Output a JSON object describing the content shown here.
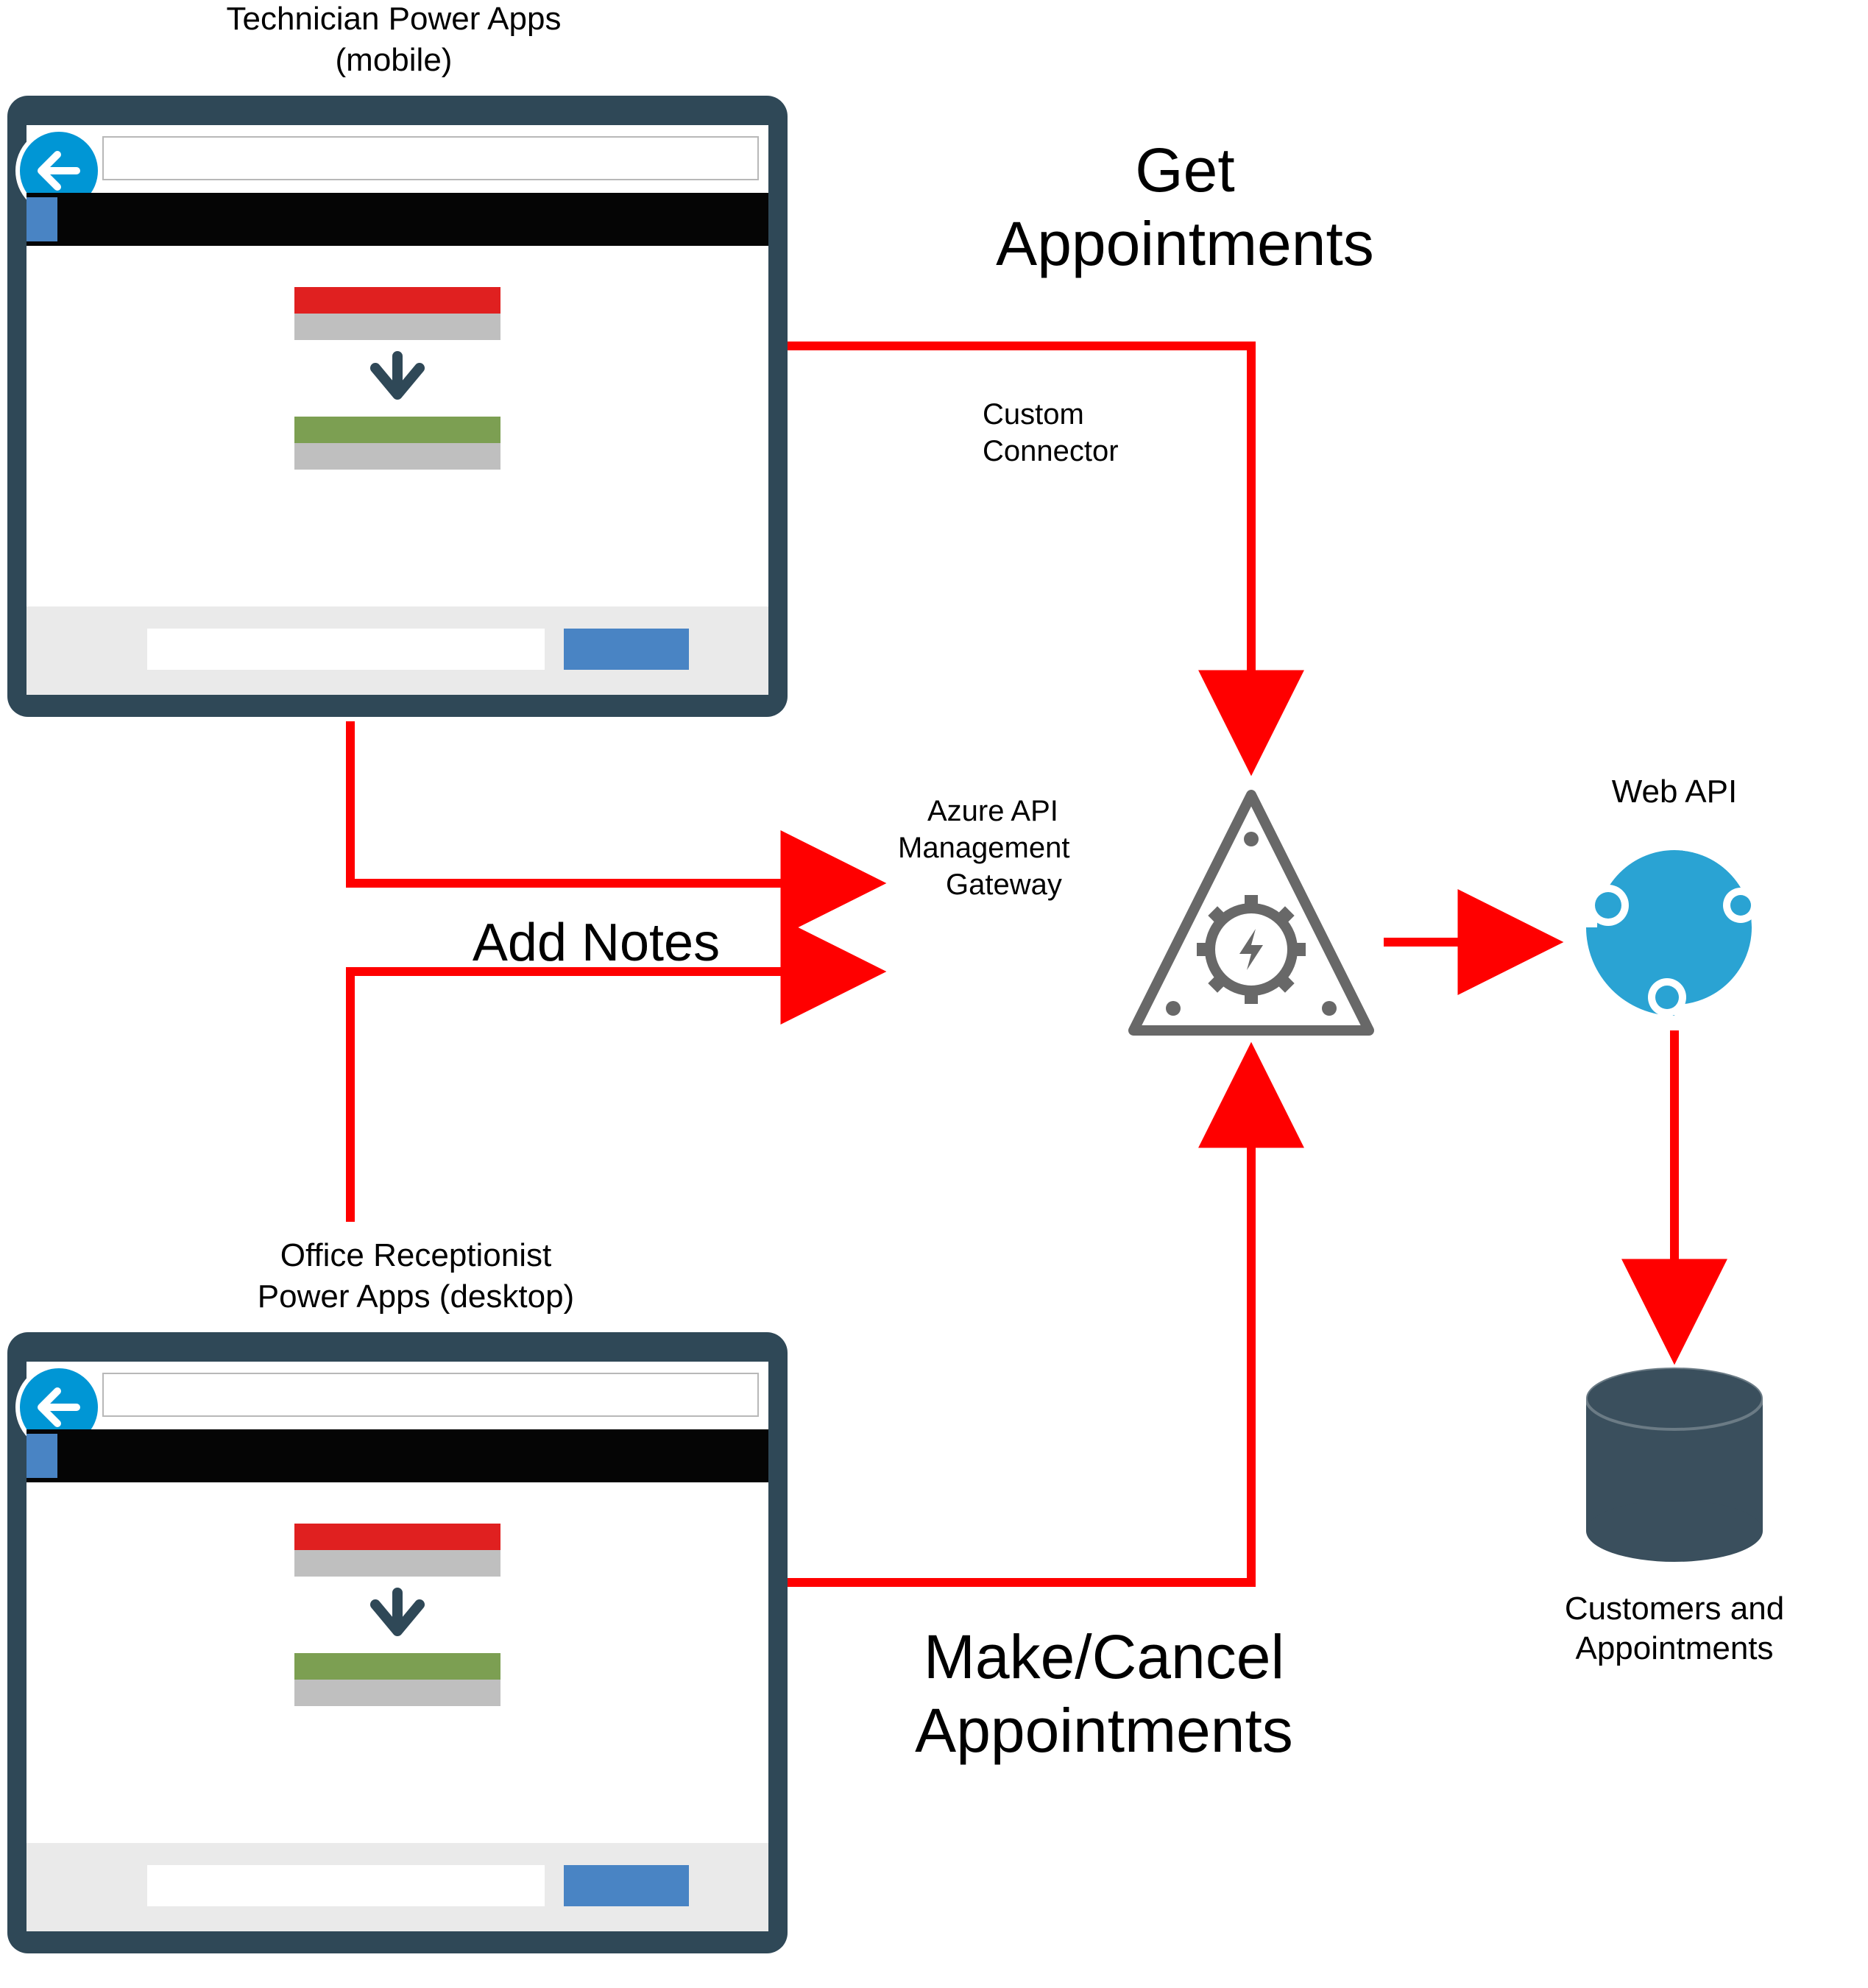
{
  "labels": {
    "technicianLine1": "Technician Power Apps",
    "technicianLine2": "(mobile)",
    "receptionistLine1": "Office Receptionist",
    "receptionistLine2": "Power Apps (desktop)",
    "getAppointmentsLine1": "Get",
    "getAppointmentsLine2": "Appointments",
    "customConnectorLine1": "Custom",
    "customConnectorLine2": "Connector",
    "addNotes": "Add Notes",
    "gatewayLine1": "Azure API",
    "gatewayLine2": "Management",
    "gatewayLine3": "Gateway",
    "makeCancelLine1": "Make/Cancel",
    "makeCancelLine2": "Appointments",
    "webApi": "Web API",
    "dbLine1": "Customers and",
    "dbLine2": "Appointments"
  },
  "colors": {
    "frame": "#2f4857",
    "white": "#ffffff",
    "black": "#050505",
    "blueAccent": "#4984c4",
    "brightBlue": "#0096d5",
    "grey": "#bfbfbf",
    "red": "#e02020",
    "green": "#7c9f52",
    "arrowRed": "#ff0000",
    "webapiBlue": "#2aa3d3",
    "dbFill": "#3a4f5d"
  }
}
